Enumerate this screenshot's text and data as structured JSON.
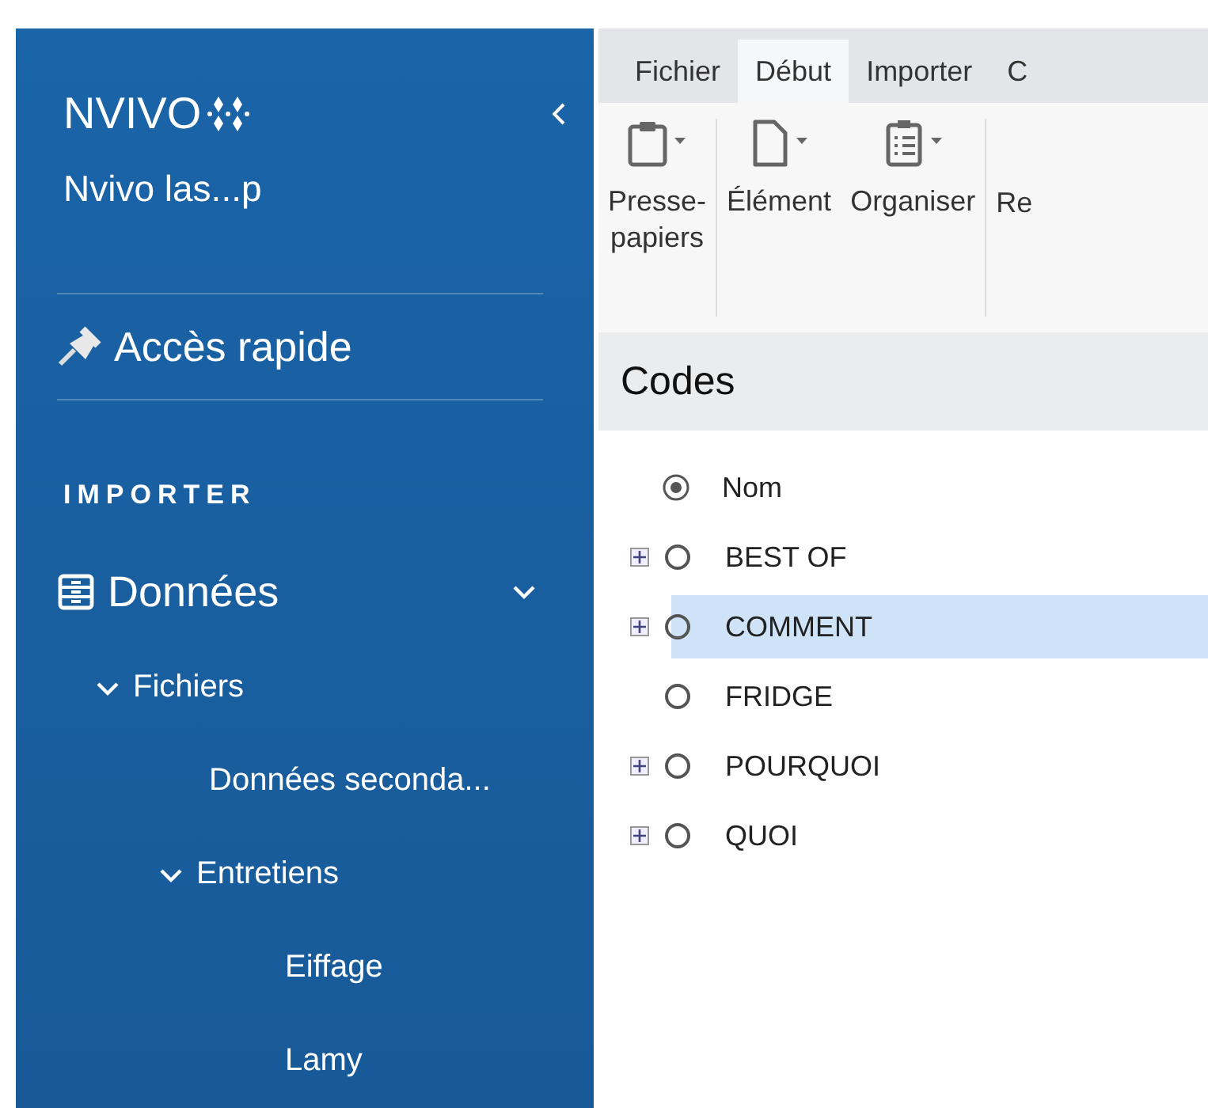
{
  "sidebar": {
    "logo": "NVIVO",
    "project": "Nvivo las...p",
    "quick_access": "Accès rapide",
    "section": "IMPORTER",
    "nav": [
      {
        "label": "Données",
        "expanded": true,
        "children": [
          {
            "label": "Fichiers",
            "expanded": true,
            "children": [
              {
                "label": "Données seconda..."
              },
              {
                "label": "Entretiens",
                "expanded": true,
                "children": [
                  {
                    "label": "Eiffage"
                  },
                  {
                    "label": "Lamy"
                  }
                ]
              }
            ]
          }
        ]
      }
    ]
  },
  "tabs": [
    {
      "label": "Fichier",
      "selected": false
    },
    {
      "label": "Début",
      "selected": true
    },
    {
      "label": "Importer",
      "selected": false
    },
    {
      "label": "C",
      "selected": false
    }
  ],
  "ribbon": [
    {
      "kind": "clipboard",
      "label": "Presse-\npapiers"
    },
    {
      "kind": "document",
      "label": "Élément"
    },
    {
      "kind": "list",
      "label": "Organiser"
    },
    {
      "kind": "none",
      "label": "Re"
    }
  ],
  "codes": {
    "title": "Codes",
    "column": "Nom",
    "items": [
      {
        "label": "BEST OF",
        "has_children": true,
        "selected": false
      },
      {
        "label": "COMMENT",
        "has_children": true,
        "selected": true
      },
      {
        "label": "FRIDGE",
        "has_children": false,
        "selected": false
      },
      {
        "label": "POURQUOI",
        "has_children": true,
        "selected": false
      },
      {
        "label": "QUOI",
        "has_children": true,
        "selected": false
      }
    ]
  }
}
